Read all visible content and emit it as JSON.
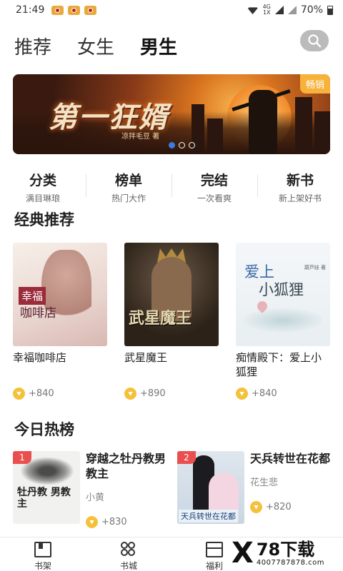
{
  "status": {
    "time": "21:49",
    "net_top": "4G",
    "net_bottom": "1X",
    "battery": "70%"
  },
  "tabs": [
    "推荐",
    "女生",
    "男生"
  ],
  "banner": {
    "title": "第一狂婿",
    "author": "凉拌毛豆 著",
    "badge": "畅销"
  },
  "categories": [
    {
      "title": "分类",
      "sub": "满目琳琅"
    },
    {
      "title": "榜单",
      "sub": "热门大作"
    },
    {
      "title": "完结",
      "sub": "一次看爽"
    },
    {
      "title": "新书",
      "sub": "新上架好书"
    }
  ],
  "classic": {
    "title": "经典推荐",
    "books": [
      {
        "name": "幸福咖啡店",
        "coins": "+840",
        "cover_line1": "幸福",
        "cover_line2": "咖啡店"
      },
      {
        "name": "武星魔王",
        "coins": "+890",
        "cover_text": "武星魔王"
      },
      {
        "name": "痴情殿下：爱上小狐狸",
        "coins": "+840",
        "cover_line1": "爱上",
        "cover_line2": "小狐狸",
        "cover_author": "葫芦娃 著"
      }
    ]
  },
  "hot": {
    "title": "今日热榜",
    "items": [
      {
        "rank": "1",
        "title": "穿越之牡丹教男教主",
        "author": "小黄",
        "coins": "+830",
        "cover_text": "牡丹教 男教主"
      },
      {
        "rank": "2",
        "title": "天兵转世在花都",
        "author": "花生悲",
        "coins": "+820",
        "cover_text": "天兵转世在花都"
      }
    ]
  },
  "bottom_nav": [
    {
      "label": "书架",
      "icon": "bookshelf-icon"
    },
    {
      "label": "书城",
      "icon": "bookstore-icon"
    },
    {
      "label": "福利",
      "icon": "gift-icon"
    }
  ],
  "watermark": {
    "big": "78下载",
    "small": "4007787878.com"
  },
  "colors": {
    "accent_yellow": "#f7c948",
    "rank_red": "#e94f4f",
    "coin_gold": "#f4c13a"
  }
}
